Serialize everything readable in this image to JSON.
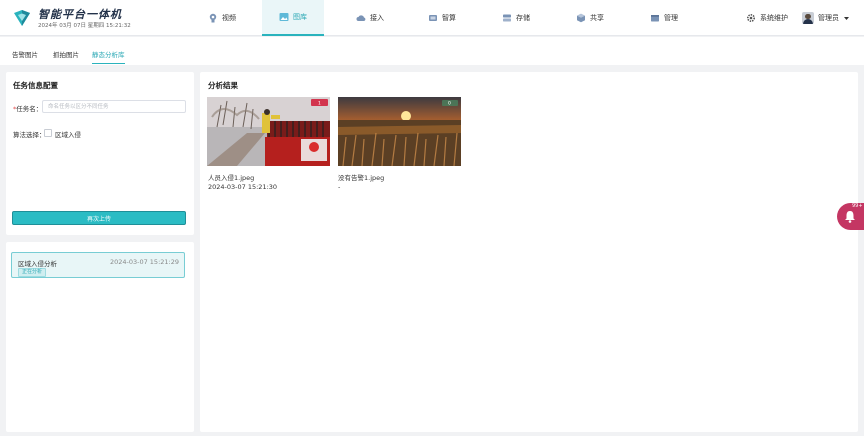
{
  "brand": {
    "title": "智能平台一体机",
    "datetime": "2024年 03月 07日 星期四 15:21:32"
  },
  "nav": [
    {
      "label": "视频",
      "icon": "camera-icon"
    },
    {
      "label": "图库",
      "icon": "image-gallery-icon",
      "active": true
    },
    {
      "label": "接入",
      "icon": "cloud-access-icon"
    },
    {
      "label": "智算",
      "icon": "compute-icon"
    },
    {
      "label": "存储",
      "icon": "storage-icon"
    },
    {
      "label": "共享",
      "icon": "share-icon"
    },
    {
      "label": "管理",
      "icon": "manage-icon"
    }
  ],
  "system": {
    "label": "系统维护",
    "icon": "gear-icon"
  },
  "user": {
    "name": "管理员",
    "icon": "avatar"
  },
  "subtabs": [
    {
      "label": "告警图片"
    },
    {
      "label": "抓拍图片"
    },
    {
      "label": "静态分析库",
      "active": true
    }
  ],
  "config": {
    "title": "任务信息配置",
    "task_name_label": "任务名：",
    "task_name_placeholder": "命名任务以区分不同任务",
    "task_name_value": "",
    "algo_label": "算法选择：",
    "algo_option": "区域入侵",
    "upload_button": "再次上传"
  },
  "tasks": [
    {
      "name": "区域入侵分析",
      "time": "2024-03-07 15:21:29",
      "status": "正在分析"
    }
  ],
  "results": {
    "title": "分析结果",
    "items": [
      {
        "filename": "人员入侵1.jpeg",
        "time": "2024-03-07 15:21:30",
        "badge": "1"
      },
      {
        "filename": "没有告警1.jpeg",
        "time": "-",
        "badge": "0"
      }
    ]
  },
  "notification": {
    "icon": "bell-icon",
    "count": "99+"
  },
  "colors": {
    "accent": "#2ab3bd",
    "alert": "#c43663",
    "required": "#e34a4a"
  }
}
